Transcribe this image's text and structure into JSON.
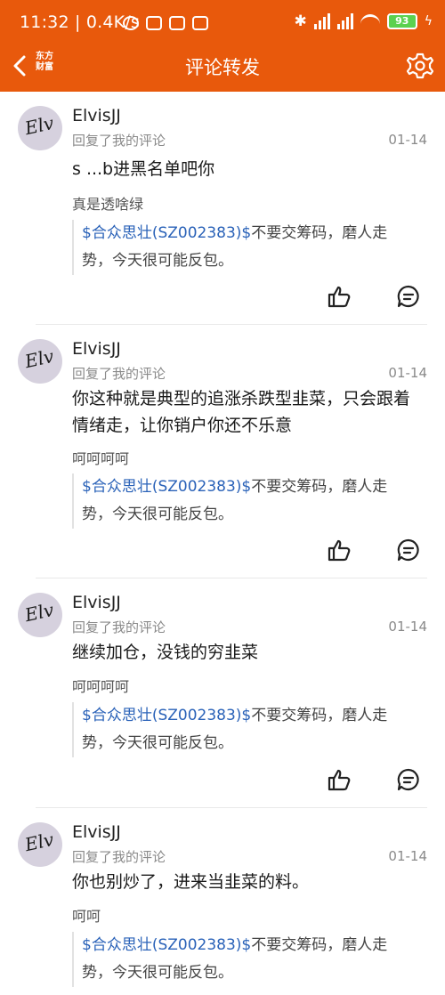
{
  "status": {
    "time": "11:32",
    "speed": "0.4K/s",
    "battery": "93"
  },
  "nav": {
    "logo_line1": "东方",
    "logo_line2": "财富",
    "title": "评论转发"
  },
  "comments": [
    {
      "name": "ElvisJJ",
      "action": "回复了我的评论",
      "date": "01-14",
      "text": "s  ...b进黑名单吧你",
      "reply": "真是透啥绿",
      "stock": "$合众思壮(SZ002383)$",
      "quote_rest": "不要交筹码，磨人走势，今天很可能反包。"
    },
    {
      "name": "ElvisJJ",
      "action": "回复了我的评论",
      "date": "01-14",
      "text": "你这种就是典型的追涨杀跌型韭菜，只会跟着情绪走，让你销户你还不乐意",
      "reply": "呵呵呵呵",
      "stock": "$合众思壮(SZ002383)$",
      "quote_rest": "不要交筹码，磨人走势，今天很可能反包。"
    },
    {
      "name": "ElvisJJ",
      "action": "回复了我的评论",
      "date": "01-14",
      "text": "继续加仓，没钱的穷韭菜",
      "reply": "呵呵呵呵",
      "stock": "$合众思壮(SZ002383)$",
      "quote_rest": "不要交筹码，磨人走势，今天很可能反包。"
    },
    {
      "name": "ElvisJJ",
      "action": "回复了我的评论",
      "date": "01-14",
      "text": "你也别炒了，进来当韭菜的料。",
      "reply": "呵呵",
      "stock": "$合众思壮(SZ002383)$",
      "quote_rest": "不要交筹码，磨人走势，今天很可能反包。"
    }
  ]
}
